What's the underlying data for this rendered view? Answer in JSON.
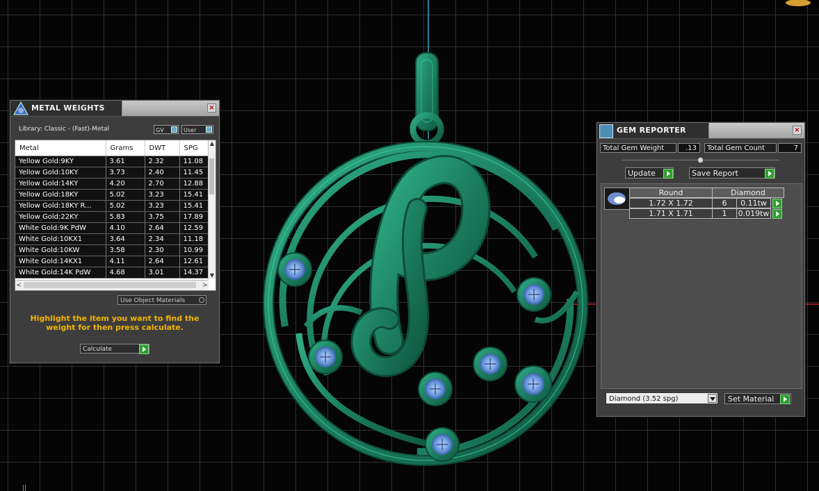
{
  "metal_weights": {
    "title": "METAL WEIGHTS",
    "library": "Library: Classic - (Fast)-Metal",
    "toggle_gv": "GV",
    "toggle_user": "User",
    "columns": [
      "Metal",
      "Grams",
      "DWT",
      "SPG"
    ],
    "rows": [
      [
        "Yellow Gold:9KY",
        "3.61",
        "2.32",
        "11.08"
      ],
      [
        "Yellow Gold:10KY",
        "3.73",
        "2.40",
        "11.45"
      ],
      [
        "Yellow Gold:14KY",
        "4.20",
        "2.70",
        "12.88"
      ],
      [
        "Yellow Gold:18KY",
        "5.02",
        "3.23",
        "15.41"
      ],
      [
        "Yellow Gold:18KY R...",
        "5.02",
        "3.23",
        "15.41"
      ],
      [
        "Yellow Gold:22KY",
        "5.83",
        "3.75",
        "17.89"
      ],
      [
        "White Gold:9K PdW",
        "4.10",
        "2.64",
        "12.59"
      ],
      [
        "White Gold:10KX1",
        "3.64",
        "2.34",
        "11.18"
      ],
      [
        "White Gold:10KW",
        "3.58",
        "2.30",
        "10.99"
      ],
      [
        "White Gold:14KX1",
        "4.11",
        "2.64",
        "12.61"
      ],
      [
        "White Gold:14K PdW",
        "4.68",
        "3.01",
        "14.37"
      ]
    ],
    "use_object_materials": "Use Object Materials",
    "instruction": "Highlight the item you want to find the weight for then press calculate.",
    "calculate": "Calculate"
  },
  "gem_reporter": {
    "title": "GEM REPORTER",
    "total_weight_label": "Total Gem Weight",
    "total_weight_value": ".13",
    "total_count_label": "Total Gem Count",
    "total_count_value": "7",
    "update": "Update",
    "save_report": "Save Report",
    "table_headers": [
      "Round",
      "Diamond"
    ],
    "gems": [
      {
        "size": "1.72 X 1.72",
        "count": "6",
        "weight": "0.11tw"
      },
      {
        "size": "1.71 X 1.71",
        "count": "1",
        "weight": "0.019tw"
      }
    ],
    "material": "Diamond     (3.52 spg)",
    "set_material": "Set Material"
  },
  "colors": {
    "metal_green": "#1f8a68",
    "gem_blue": "#6f9de0",
    "accent_button": "#2e9e2e",
    "instruction_text": "#f2b400"
  }
}
